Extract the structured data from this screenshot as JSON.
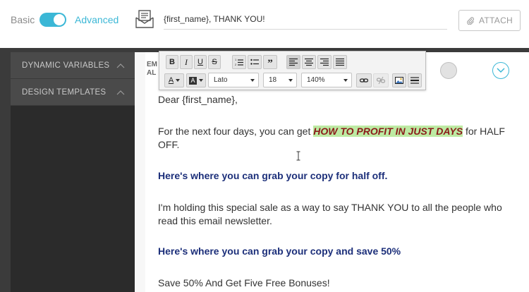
{
  "header": {
    "mode_basic": "Basic",
    "mode_advanced": "Advanced",
    "toggle_state": "advanced",
    "subject_value": "{first_name}, THANK YOU!",
    "attach_label": "ATTACH"
  },
  "sidebar": {
    "sections": [
      {
        "label": "DYNAMIC VARIABLES"
      },
      {
        "label": "DESIGN TEMPLATES"
      }
    ]
  },
  "editor": {
    "label_line1": "EM",
    "label_line2": "AL"
  },
  "toolbar": {
    "bold": "B",
    "italic": "I",
    "underline": "U",
    "strike": "S",
    "font_color": "A",
    "bg_color": "A",
    "font_family": "Lato",
    "font_size": "18",
    "line_height": "140%"
  },
  "email": {
    "greeting": "Dear {first_name},",
    "p1_before": "For the next four days, you can get ",
    "p1_highlight": "HOW TO PROFIT IN JUST DAYS",
    "p1_after": " for HALF",
    "p1_line2": "OFF.",
    "link1": "Here's where you can grab your copy for half off.",
    "p2_line1": "I'm holding this special sale as a way to say THANK YOU to all the people who",
    "p2_line2": "read this email newsletter.",
    "link2": "Here's where you can grab your copy and save 50%",
    "p3": "Save 50% And Get Five Free Bonuses!"
  },
  "colors": {
    "accent": "#3bb7d6",
    "sidebar_dark": "#2b2b2b",
    "sidebar_section": "#4a4a4a",
    "highlight_bg": "#bdeaa3",
    "highlight_text": "#8b1a1a",
    "link_text": "#1c2f7a"
  }
}
